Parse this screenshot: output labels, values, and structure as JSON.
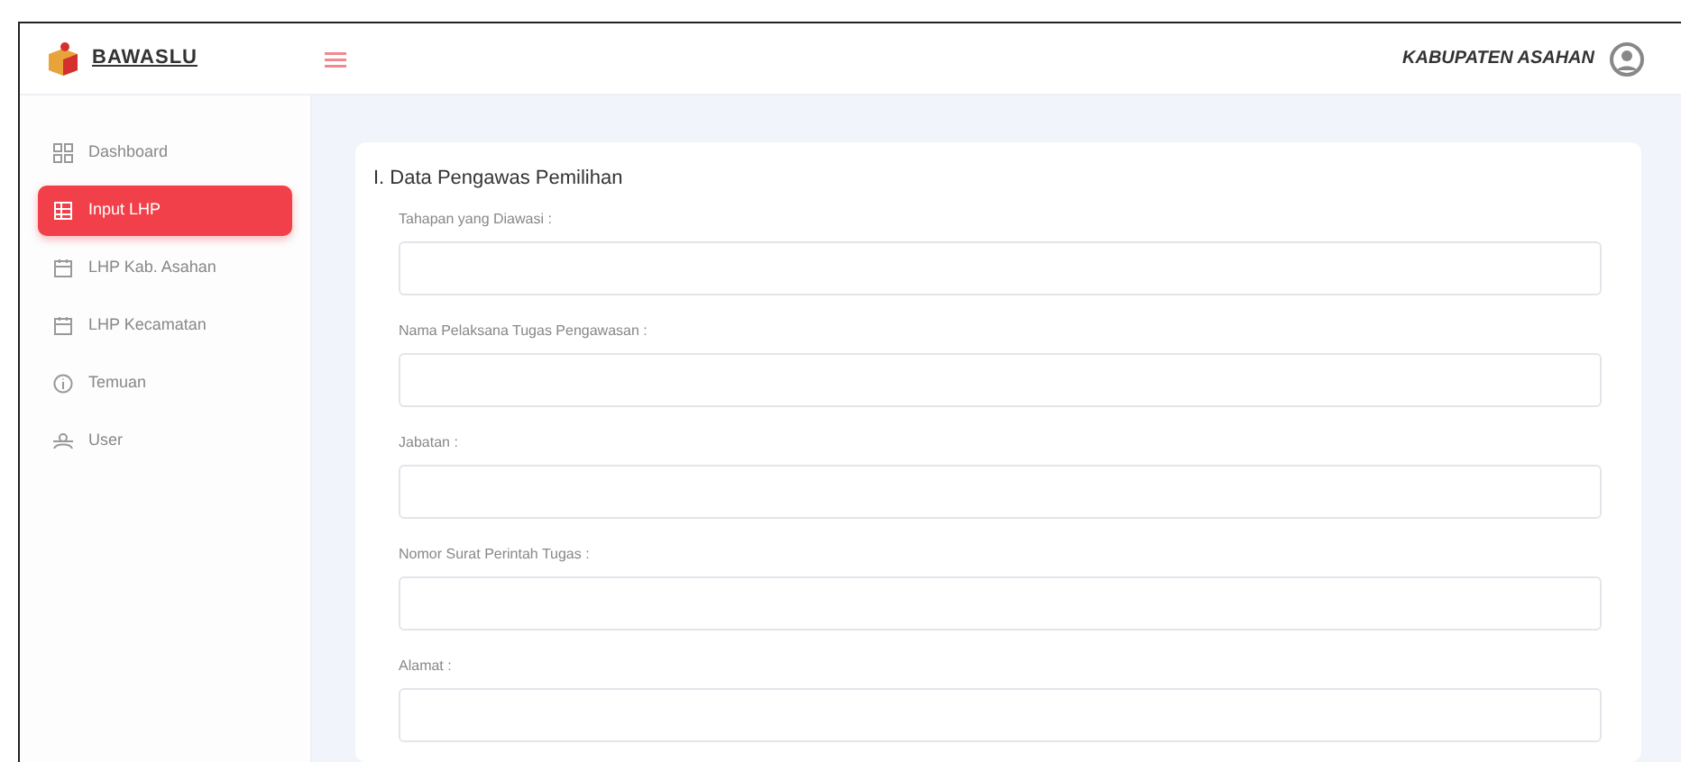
{
  "header": {
    "brand": "BAWASLU",
    "user": "KABUPATEN ASAHAN"
  },
  "sidebar": {
    "items": [
      {
        "label": "Dashboard",
        "selected": false
      },
      {
        "label": "Input LHP",
        "selected": true
      },
      {
        "label": "LHP Kab. Asahan",
        "selected": false
      },
      {
        "label": "LHP Kecamatan",
        "selected": false
      },
      {
        "label": "Temuan",
        "selected": false
      },
      {
        "label": "User",
        "selected": false
      }
    ]
  },
  "form": {
    "title": "I. Data Pengawas Pemilihan",
    "fields": [
      {
        "label": "Tahapan yang Diawasi :"
      },
      {
        "label": "Nama Pelaksana Tugas Pengawasan :"
      },
      {
        "label": "Jabatan :"
      },
      {
        "label": "Nomor Surat Perintah Tugas :"
      },
      {
        "label": "Alamat :"
      }
    ]
  }
}
